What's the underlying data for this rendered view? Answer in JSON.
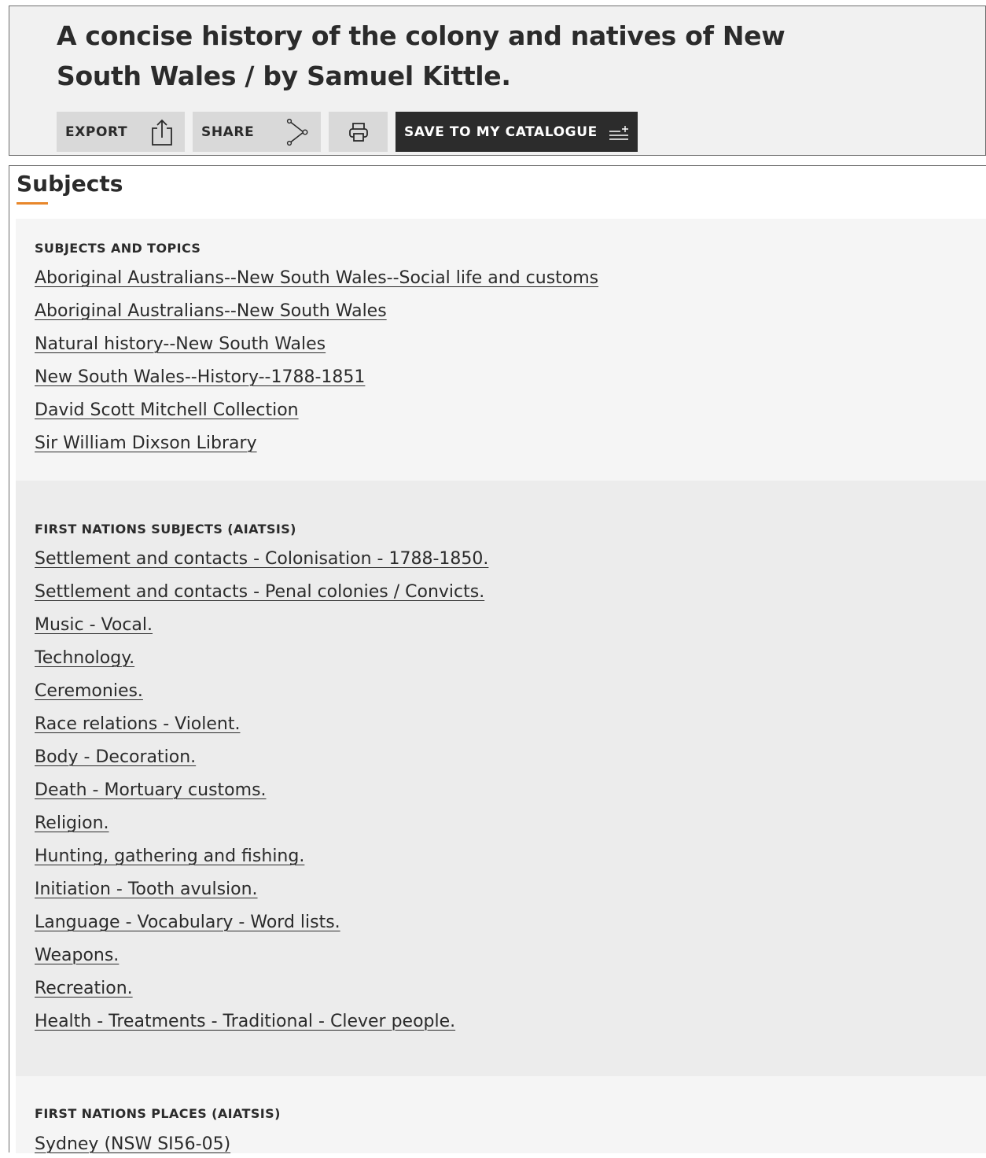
{
  "header": {
    "title": "A concise history of the colony and natives of New South Wales / by Samuel Kittle.",
    "toolbar": {
      "export_label": "EXPORT",
      "export_icon": "share-upload-icon",
      "share_label": "SHARE",
      "share_icon": "share-nodes-icon",
      "print_icon": "printer-icon",
      "save_label": "SAVE TO MY CATALOGUE",
      "save_icon": "add-to-list-icon"
    }
  },
  "subjects": {
    "heading": "Subjects",
    "accent_color": "#e8872b",
    "groups": [
      {
        "label": "SUBJECTS AND TOPICS",
        "links": [
          "Aboriginal Australians--New South Wales--Social life and customs",
          "Aboriginal Australians--New South Wales",
          "Natural history--New South Wales",
          "New South Wales--History--1788-1851",
          "David Scott Mitchell Collection",
          "Sir William Dixson Library"
        ]
      },
      {
        "label": "FIRST NATIONS SUBJECTS (AIATSIS)",
        "links": [
          "Settlement and contacts - Colonisation - 1788-1850.",
          "Settlement and contacts - Penal colonies / Convicts.",
          "Music - Vocal.",
          "Technology.",
          "Ceremonies.",
          "Race relations - Violent.",
          "Body - Decoration.",
          "Death - Mortuary customs.",
          "Religion.",
          "Hunting, gathering and fishing.",
          "Initiation - Tooth avulsion.",
          "Language - Vocabulary - Word lists.",
          "Weapons.",
          "Recreation.",
          "Health - Treatments - Traditional - Clever people."
        ]
      },
      {
        "label": "FIRST NATIONS PLACES (AIATSIS)",
        "links": [
          "Sydney (NSW SI56-05)"
        ]
      }
    ]
  }
}
